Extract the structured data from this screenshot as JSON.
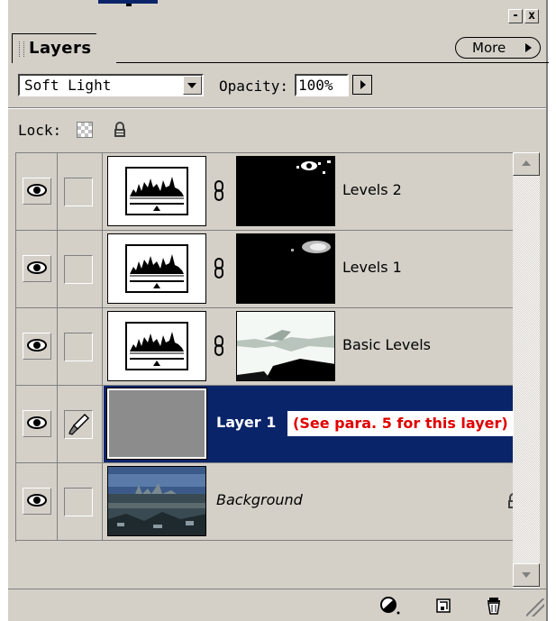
{
  "window": {
    "minimize_glyph": "-",
    "close_glyph": "x"
  },
  "tab": {
    "label": "Layers"
  },
  "more_button": {
    "label": "More"
  },
  "blend": {
    "mode": "Soft Light",
    "opacity_label": "Opacity:",
    "opacity_value": "100%"
  },
  "lock": {
    "label": "Lock:"
  },
  "layers": [
    {
      "name": "Levels 2",
      "visible": true,
      "type": "adjustment",
      "icon": "levels-histogram-icon"
    },
    {
      "name": "Levels 1",
      "visible": true,
      "type": "adjustment",
      "icon": "levels-histogram-icon"
    },
    {
      "name": "Basic Levels",
      "visible": true,
      "type": "adjustment",
      "icon": "levels-histogram-icon"
    },
    {
      "name": "Layer 1",
      "visible": true,
      "type": "pixel",
      "selected": true,
      "icon": "brush-icon"
    },
    {
      "name": "Background",
      "visible": true,
      "type": "background",
      "locked": true,
      "icon": "lock-icon"
    }
  ],
  "annotation": {
    "text": "(See para. 5 for this layer)"
  },
  "colors": {
    "panel": "#d4d0c8",
    "selection": "#0a246a",
    "annotation": "#e00000"
  },
  "bottom_icons": [
    "adjustment-layer-icon",
    "new-layer-icon",
    "trash-icon"
  ]
}
